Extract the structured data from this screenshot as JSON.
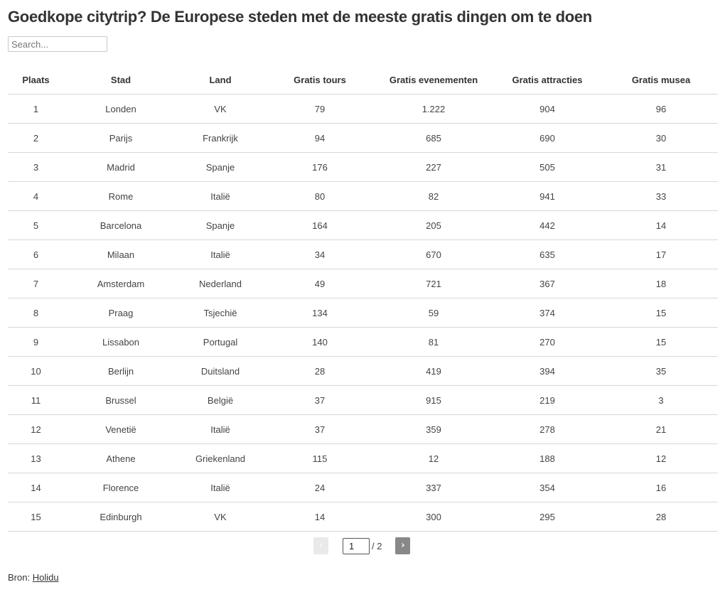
{
  "title": "Goedkope citytrip? De Europese steden met de meeste gratis dingen om te doen",
  "search": {
    "placeholder": "Search...",
    "value": ""
  },
  "table": {
    "columns": [
      "Plaats",
      "Stad",
      "Land",
      "Gratis tours",
      "Gratis evenementen",
      "Gratis attracties",
      "Gratis musea"
    ],
    "rows": [
      [
        "1",
        "Londen",
        "VK",
        "79",
        "1.222",
        "904",
        "96"
      ],
      [
        "2",
        "Parijs",
        "Frankrijk",
        "94",
        "685",
        "690",
        "30"
      ],
      [
        "3",
        "Madrid",
        "Spanje",
        "176",
        "227",
        "505",
        "31"
      ],
      [
        "4",
        "Rome",
        "Italië",
        "80",
        "82",
        "941",
        "33"
      ],
      [
        "5",
        "Barcelona",
        "Spanje",
        "164",
        "205",
        "442",
        "14"
      ],
      [
        "6",
        "Milaan",
        "Italië",
        "34",
        "670",
        "635",
        "17"
      ],
      [
        "7",
        "Amsterdam",
        "Nederland",
        "49",
        "721",
        "367",
        "18"
      ],
      [
        "8",
        "Praag",
        "Tsjechië",
        "134",
        "59",
        "374",
        "15"
      ],
      [
        "9",
        "Lissabon",
        "Portugal",
        "140",
        "81",
        "270",
        "15"
      ],
      [
        "10",
        "Berlijn",
        "Duitsland",
        "28",
        "419",
        "394",
        "35"
      ],
      [
        "11",
        "Brussel",
        "België",
        "37",
        "915",
        "219",
        "3"
      ],
      [
        "12",
        "Venetië",
        "Italië",
        "37",
        "359",
        "278",
        "21"
      ],
      [
        "13",
        "Athene",
        "Griekenland",
        "115",
        "12",
        "188",
        "12"
      ],
      [
        "14",
        "Florence",
        "Italië",
        "24",
        "337",
        "354",
        "16"
      ],
      [
        "15",
        "Edinburgh",
        "VK",
        "14",
        "300",
        "295",
        "28"
      ]
    ]
  },
  "pagination": {
    "prev_label": "‹",
    "next_label": "›",
    "current_page": "1",
    "total_label": "/ 2"
  },
  "source": {
    "label": "Bron:",
    "link_text": "Holidu"
  }
}
